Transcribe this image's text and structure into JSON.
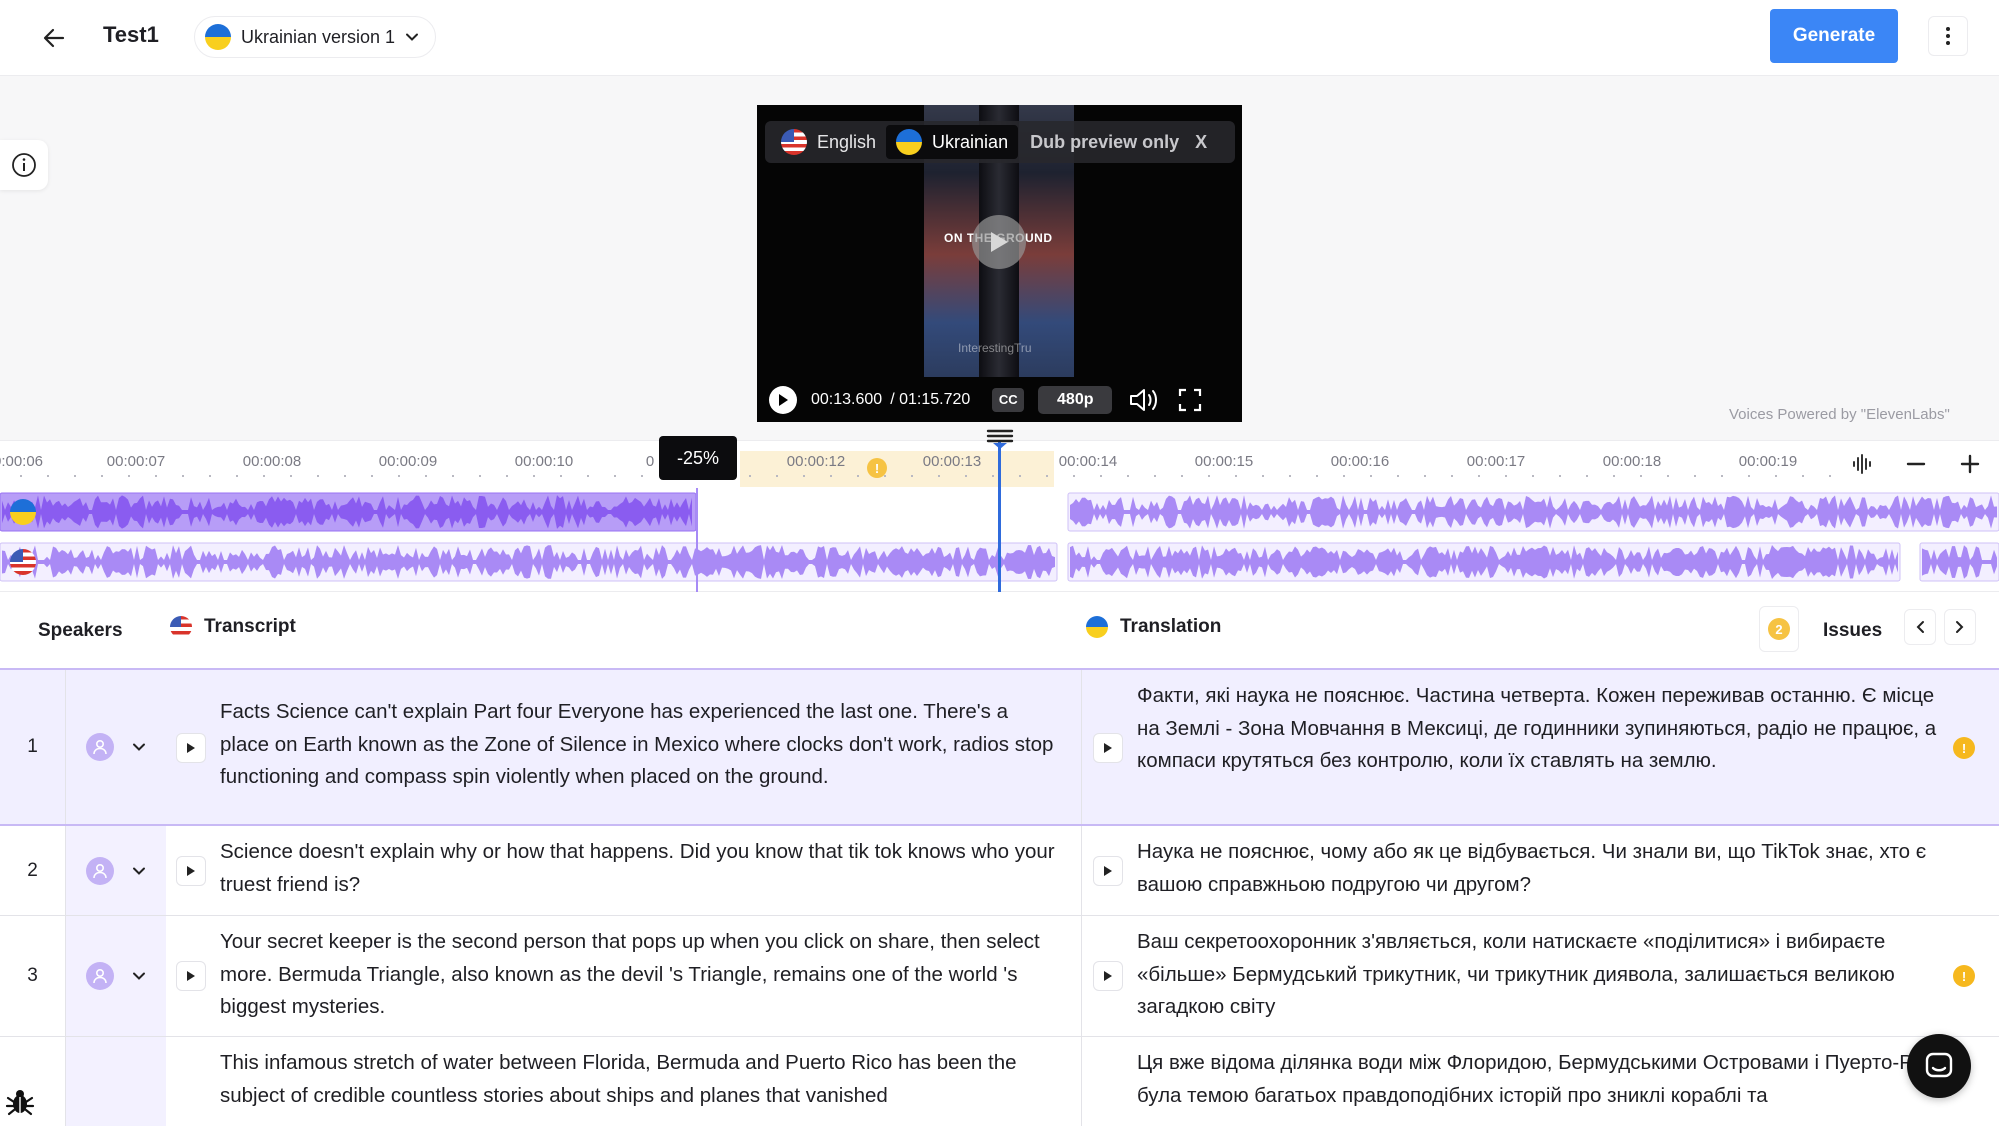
{
  "header": {
    "title": "Test1",
    "version_label": "Ukrainian version 1",
    "generate_label": "Generate"
  },
  "video": {
    "languages": [
      {
        "label": "English",
        "flag": "us"
      },
      {
        "label": "Ukrainian",
        "flag": "ua"
      }
    ],
    "dub_note": "Dub preview only",
    "close_label": "X",
    "current_time": "00:13.600",
    "total_time": "/ 01:15.720",
    "cc_label": "CC",
    "quality": "480p",
    "frame_caption": "ON THE GROUND",
    "frame_watermark": "InterestingTru",
    "playback_progress": 0.18
  },
  "voices_note": "Voices Powered by \"ElevenLabs\"",
  "timeline": {
    "ticks": [
      "0:00:06",
      "00:00:07",
      "00:00:08",
      "00:00:09",
      "00:00:10",
      "0",
      "00:00:12",
      "00:00:13",
      "00:00:14",
      "00:00:15",
      "00:00:16",
      "00:00:17",
      "00:00:18",
      "00:00:19"
    ],
    "speed_tooltip": "-25%",
    "warning_badge": "!"
  },
  "table": {
    "speakers_label": "Speakers",
    "transcript_label": "Transcript",
    "translation_label": "Translation",
    "issues_count": "2",
    "issues_label": "Issues",
    "rows": [
      {
        "num": "1",
        "source": "Facts Science can't explain Part four Everyone has experienced the last one. There's a place on Earth known as the Zone of Silence in Mexico where clocks don't work, radios stop functioning and compass spin violently when placed on the ground.",
        "translation": "Факти, які наука не пояснює. Частина четверта. Кожен переживав останню. Є місце на Землі - Зона Мовчання в Мексиці, де годинники зупиняються, радіо не працює, а компаси крутяться без контролю, коли їх ставлять на землю.",
        "warning": "!"
      },
      {
        "num": "2",
        "source": "Science doesn't explain why or how that happens. Did you know that tik tok knows who your truest friend is?",
        "translation": "Наука не пояснює, чому або як це відбувається. Чи знали ви, що TikTok знає, хто є вашою справжньою подругою чи другом?",
        "warning": ""
      },
      {
        "num": "3",
        "source": "Your secret keeper is the second person that pops up when you click on share, then select more. Bermuda Triangle, also known as the devil 's Triangle, remains one of the world 's biggest mysteries.",
        "translation": "Ваш секретоохоронник з'являється, коли натискаєте «поділитися» і вибираєте «більше» Бермудський трикутник, чи трикутник диявола, залишається великою загадкою світу",
        "warning": "!"
      },
      {
        "num": "",
        "source": "This infamous stretch of water between Florida, Bermuda and Puerto Rico has been the subject of credible countless stories about ships and planes that vanished",
        "translation": "Ця вже відома ділянка води між Флоридою, Бермудськими Островами і Пуерто-Рико була темою багатьох правдоподібних історій про зниклі кораблі та",
        "warning": ""
      }
    ]
  },
  "colors": {
    "accent": "#3b86f6",
    "wave": "#a98af5",
    "wave_selected": "#9a72f3",
    "playhead": "#2f6bdc",
    "warning": "#f6c343",
    "row_active": "#f1efff"
  },
  "icons": [
    "back-arrow-icon",
    "chevron-down-icon",
    "kebab-menu-icon",
    "info-icon",
    "play-icon",
    "volume-icon",
    "fullscreen-icon",
    "waveform-icon",
    "minus-icon",
    "plus-icon",
    "chevron-left-icon",
    "chevron-right-icon",
    "user-icon",
    "warning-icon",
    "bug-icon",
    "chat-icon"
  ]
}
